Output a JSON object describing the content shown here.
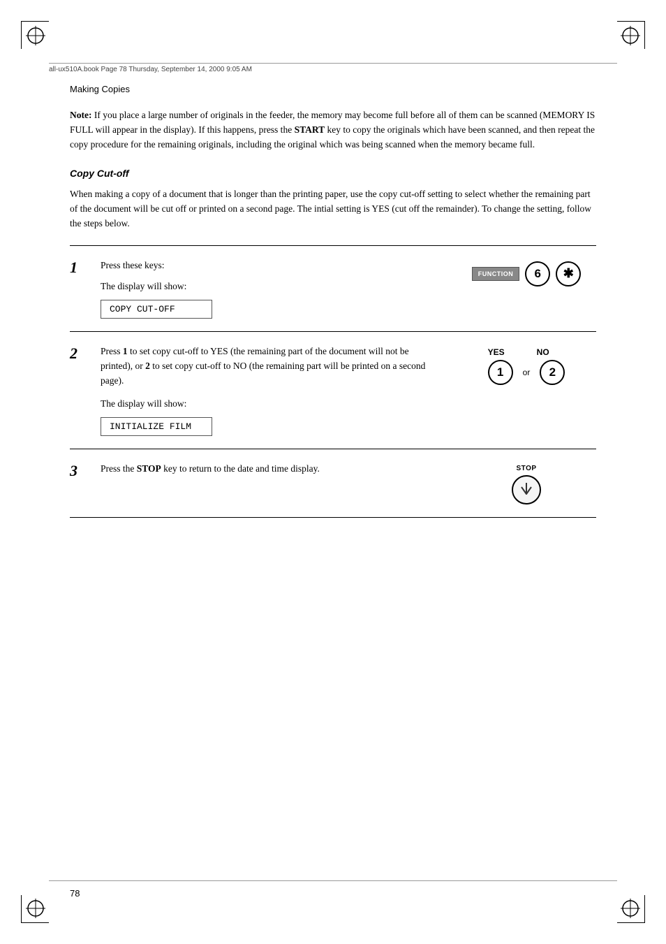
{
  "header": {
    "file_info": "all-ux510A.book  Page 78  Thursday, September 14, 2000  9:05 AM",
    "section": "Making Copies"
  },
  "note": {
    "label": "Note:",
    "text": " If you place a large number of originals in the feeder, the memory may become full before all of them can be scanned (MEMORY IS FULL will appear in the display). If this happens, press the ",
    "bold_word": "START",
    "text2": " key to copy the originals which have been scanned, and then repeat the copy procedure for the remaining originals, including the original which was being scanned when the memory became full."
  },
  "copy_cutoff": {
    "heading": "Copy Cut-off",
    "description": "When making a copy of a document that is longer than the printing paper, use the copy cut-off setting to select whether the remaining part of the document will be cut off or printed on a second page. The intial setting is YES (cut off the remainder). To change the setting, follow the steps below."
  },
  "steps": [
    {
      "number": "1",
      "instruction": "Press these keys:",
      "display_label": "The display will show:",
      "display_value": "COPY CUT-OFF",
      "keys": {
        "function_label": "FUNCTION",
        "key1": "6",
        "key2": "✱"
      }
    },
    {
      "number": "2",
      "instruction_parts": [
        "Press ",
        "1",
        " to set copy cut-off to YES (the remaining part of the document will not be printed), or ",
        "2",
        " to set copy cut-off to NO (the remaining part will be printed on a second page)."
      ],
      "display_label": "The display will show:",
      "display_value": "INITIALIZE FILM",
      "keys": {
        "yes_label": "YES",
        "no_label": "NO",
        "yes_key": "1",
        "no_key": "2",
        "or_label": "or"
      }
    },
    {
      "number": "3",
      "instruction_before": "Press the ",
      "bold_word": "STOP",
      "instruction_after": " key to return to the date and time display.",
      "keys": {
        "stop_label": "STOP"
      }
    }
  ],
  "page_number": "78"
}
